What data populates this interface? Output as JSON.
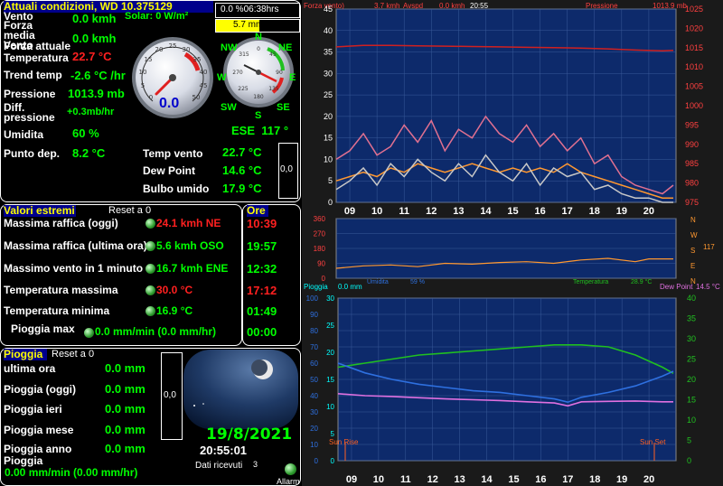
{
  "conditions": {
    "title": "Attuali condizioni, WD 10.375129",
    "solar": "Solar: 0 W/m²",
    "wind_label": "Vento",
    "wind_value": "0.0 kmh",
    "avg_wind_label": "Forza media Vento",
    "avg_wind_value": "0.0 kmh",
    "current_force_label": "Forza attuale",
    "temp_label": "Temperatura",
    "temp_value": "22.7 °C",
    "trend_label": "Trend temp",
    "trend_value": "-2.6 °C /hr",
    "pressure_label": "Pressione",
    "pressure_value": "1013.9 mb",
    "pressure_diff_label": "Diff. pressione",
    "pressure_diff_value": "+0.3mb/hr",
    "humidity_label": "Umidita",
    "humidity_value": "60 %",
    "dewpoint_label": "Punto dep.",
    "dewpoint_value": "8.2 °C",
    "wind_temp_label": "Temp vento",
    "wind_temp_value": "22.7 °C",
    "dew_point_label": "Dew Point",
    "dew_point_value": "14.6 °C",
    "wet_bulb_label": "Bulbo umido",
    "wet_bulb_value": "17.9 °C",
    "side_box_value": "0,0",
    "speed_gauge_value": "0.0",
    "direction_text": "ESE  117 °",
    "status_time": "0.0 %06:38hrs",
    "status_et": "5.7 mm ET",
    "compass_labels": [
      "N",
      "NE",
      "E",
      "SE",
      "S",
      "SW",
      "W",
      "NW"
    ]
  },
  "extremes": {
    "title": "Valori estremi",
    "reset": "Reset a 0",
    "hours_title": "Ore",
    "rows": [
      {
        "label": "Massima raffica (oggi)",
        "value": "24.1 kmh NE",
        "time": "10:39",
        "value_color": "#ff2020",
        "time_color": "#ff2020"
      },
      {
        "label": "Massima raffica (ultima ora)",
        "value": "5.6 kmh OSO",
        "time": "19:57",
        "value_color": "#00ff00",
        "time_color": "#00ff00"
      },
      {
        "label": "Massimo vento in 1 minuto",
        "value": "16.7 kmh ENE",
        "time": "12:32",
        "value_color": "#00ff00",
        "time_color": "#00ff00"
      },
      {
        "label": "Temperatura massima",
        "value": "30.0 °C",
        "time": "17:12",
        "value_color": "#ff2020",
        "time_color": "#ff2020"
      },
      {
        "label": "Temperatura minima",
        "value": "16.9 °C",
        "time": "01:49",
        "value_color": "#00ff00",
        "time_color": "#00ff00"
      },
      {
        "label": "Pioggia max",
        "value": "0.0 mm/min (0.0 mm/hr)",
        "time": "00:00",
        "value_color": "#00ff00",
        "time_color": "#00ff00"
      }
    ]
  },
  "rain": {
    "title": "Pioggia",
    "reset": "Reset a 0",
    "rows": [
      {
        "label": "ultima ora",
        "value": "0.0 mm"
      },
      {
        "label": "Pioggia (oggi)",
        "value": "0.0 mm"
      },
      {
        "label": "Pioggia ieri",
        "value": "0.0 mm"
      },
      {
        "label": "Pioggia mese",
        "value": "0.0 mm"
      },
      {
        "label": "Pioggia anno",
        "value": "0.0 mm"
      }
    ],
    "rate_label": "Pioggia",
    "rate_value": "0.00 mm/min (0.00 mm/hr)",
    "side_box_value": "0,0",
    "date": "19/8/2021",
    "time": "20:55:01",
    "data_received_label": "Dati ricevuti",
    "data_received_value": "3",
    "alarm_label": "Allarm"
  },
  "chart_data": [
    {
      "type": "line",
      "header": {
        "left": "Forza vento)",
        "wind": "3.7 kmh",
        "avg": "Avspd",
        "avg_value": "0.0 kmh",
        "time": "20:55",
        "pressure_label": "Pressione",
        "pressure_value": "1013.9 mb"
      },
      "x_ticks": [
        "09",
        "10",
        "11",
        "12",
        "13",
        "14",
        "15",
        "16",
        "17",
        "18",
        "19",
        "20"
      ],
      "y_left_ticks": [
        "0",
        "5",
        "10",
        "15",
        "20",
        "25",
        "30",
        "35",
        "40",
        "45"
      ],
      "y_right_ticks": [
        "975",
        "980",
        "985",
        "990",
        "995",
        "1000",
        "1005",
        "1010",
        "1015",
        "1020",
        "1025"
      ],
      "ylim_left": [
        0,
        45
      ],
      "ylim_right": [
        975,
        1025
      ],
      "series": [
        {
          "color": "#d02020",
          "axis": "right",
          "x": [
            8.5,
            9.5,
            10.5,
            11.5,
            12.5,
            13.5,
            14.5,
            15.5,
            16.5,
            17.5,
            18.5,
            19.5,
            20.5,
            20.9
          ],
          "y": [
            1015.2,
            1015.6,
            1015.6,
            1015.5,
            1015.4,
            1015.3,
            1015.2,
            1015.1,
            1015.0,
            1014.9,
            1014.7,
            1014.4,
            1014.2,
            1014.3
          ]
        },
        {
          "color": "#e07090",
          "axis": "left",
          "x": [
            8.5,
            9.0,
            9.5,
            10.0,
            10.5,
            11.0,
            11.5,
            12.0,
            12.5,
            13.0,
            13.5,
            14.0,
            14.5,
            15.0,
            15.5,
            16.0,
            16.5,
            17.0,
            17.5,
            18.0,
            18.5,
            19.0,
            19.5,
            20.0,
            20.5,
            20.9
          ],
          "y": [
            10,
            12,
            16,
            11,
            13,
            18,
            14,
            19,
            12,
            17,
            15,
            20,
            16,
            14,
            18,
            13,
            16,
            12,
            15,
            9,
            11,
            6,
            4,
            3,
            2,
            4
          ]
        },
        {
          "color": "#ff9830",
          "axis": "left",
          "x": [
            8.5,
            9.0,
            9.5,
            10.0,
            10.5,
            11.0,
            11.5,
            12.0,
            12.5,
            13.0,
            13.5,
            14.0,
            14.5,
            15.0,
            15.5,
            16.0,
            16.5,
            17.0,
            17.5,
            18.0,
            18.5,
            19.0,
            19.5,
            20.0,
            20.5,
            20.9
          ],
          "y": [
            5,
            6,
            7,
            6,
            8,
            7,
            9,
            8,
            7,
            8,
            9,
            8,
            7,
            8,
            7,
            8,
            7,
            9,
            7,
            6,
            5,
            4,
            3,
            2,
            1,
            1
          ]
        },
        {
          "color": "#c8c8c8",
          "axis": "left",
          "x": [
            8.5,
            9.0,
            9.5,
            10.0,
            10.5,
            11.0,
            11.5,
            12.0,
            12.5,
            13.0,
            13.5,
            14.0,
            14.5,
            15.0,
            15.5,
            16.0,
            16.5,
            17.0,
            17.5,
            18.0,
            18.5,
            19.0,
            19.5,
            20.0,
            20.5,
            20.9
          ],
          "y": [
            3,
            5,
            8,
            4,
            9,
            6,
            10,
            7,
            5,
            9,
            6,
            11,
            7,
            5,
            9,
            4,
            8,
            6,
            7,
            3,
            4,
            2,
            1,
            1,
            0,
            0
          ]
        }
      ]
    },
    {
      "type": "line",
      "y_ticks": [
        "360",
        "270",
        "180",
        "90",
        "0"
      ],
      "ylim": [
        0,
        360
      ],
      "right_labels": [
        "N",
        "W",
        "S",
        "E",
        "N"
      ],
      "right_value": "117",
      "series": [
        {
          "color": "#ff9830",
          "x": [
            8.5,
            9.5,
            10.5,
            11.5,
            12.5,
            13.5,
            14.5,
            15.5,
            16.5,
            17.5,
            18.5,
            19.5,
            20.0,
            20.9
          ],
          "y": [
            60,
            75,
            80,
            70,
            90,
            85,
            95,
            100,
            90,
            110,
            120,
            100,
            117,
            117
          ]
        }
      ]
    },
    {
      "type": "line",
      "header": {
        "rain_label": "Pioggia",
        "rain_value": "0.0 mm",
        "humidity_label": "Umidita",
        "humidity_value": "59 %",
        "temp_label": "Temperatura",
        "temp_value": "28.9 °C",
        "dew_label": "Dew Point",
        "dew_value": "14.5 °C"
      },
      "x_ticks": [
        "09",
        "10",
        "11",
        "12",
        "13",
        "14",
        "15",
        "16",
        "17",
        "18",
        "19",
        "20"
      ],
      "y_left_ticks": [
        "0",
        "10",
        "20",
        "30",
        "40",
        "50",
        "60",
        "70",
        "80",
        "90",
        "100"
      ],
      "y_mid_ticks": [
        "0",
        "5",
        "10",
        "15",
        "20",
        "25",
        "30"
      ],
      "y_right_ticks": [
        "0",
        "5",
        "10",
        "15",
        "20",
        "25",
        "30",
        "35",
        "40"
      ],
      "ylim_left": [
        0,
        100
      ],
      "ylim_right": [
        0,
        40
      ],
      "sunrise_label": "Sun Rise",
      "sunset_label": "Sun Set",
      "series": [
        {
          "color": "#20c020",
          "axis": "right",
          "x": [
            8.5,
            9.5,
            10.5,
            11.5,
            12.5,
            13.5,
            14.5,
            15.5,
            16.5,
            17.5,
            18.5,
            19.5,
            20.5,
            20.9
          ],
          "y": [
            23,
            24,
            25,
            26,
            26.5,
            27,
            27.5,
            28,
            28.5,
            28.5,
            28,
            26,
            23,
            21.5
          ]
        },
        {
          "color": "#2e70e0",
          "axis": "left",
          "x": [
            8.5,
            9.5,
            10.5,
            11.5,
            12.5,
            13.5,
            14.5,
            15.5,
            16.5,
            17.0,
            17.5,
            18.5,
            19.5,
            20.5,
            20.9
          ],
          "y": [
            60,
            54,
            50,
            47,
            45,
            43,
            42,
            40,
            38,
            36,
            39,
            42,
            46,
            52,
            55
          ]
        },
        {
          "color": "#e070e0",
          "axis": "right",
          "x": [
            8.5,
            9.5,
            10.5,
            11.5,
            12.5,
            13.5,
            14.5,
            15.5,
            16.5,
            17.0,
            17.5,
            18.5,
            19.5,
            20.5,
            20.9
          ],
          "y": [
            16.5,
            16,
            15.8,
            15.5,
            15.2,
            15,
            14.8,
            14.5,
            14.2,
            13.5,
            14.5,
            14.6,
            14.7,
            14.5,
            14.5
          ]
        }
      ]
    }
  ]
}
